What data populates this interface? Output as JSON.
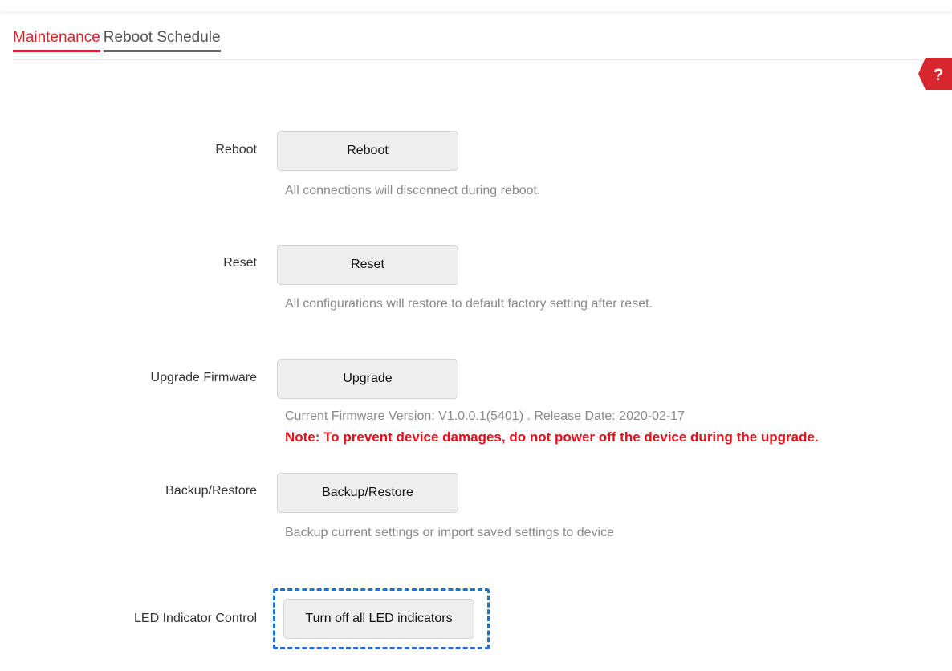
{
  "tabs": [
    {
      "label": "Maintenance",
      "active": true
    },
    {
      "label": "Reboot Schedule",
      "active": false
    }
  ],
  "help_icon": {
    "icon": "help-icon",
    "glyph": "?",
    "color": "#d7262e"
  },
  "rows": {
    "reboot": {
      "label": "Reboot",
      "button": "Reboot",
      "description": "All connections will disconnect during reboot."
    },
    "reset": {
      "label": "Reset",
      "button": "Reset",
      "description": "All configurations will restore to default factory setting after reset."
    },
    "upgrade": {
      "label": "Upgrade Firmware",
      "button": "Upgrade",
      "description": "Current Firmware Version: V1.0.0.1(5401) . Release Date: 2020-02-17",
      "note": "Note: To prevent device damages, do not power off the device during the upgrade."
    },
    "backup": {
      "label": "Backup/Restore",
      "button": "Backup/Restore",
      "description": "Backup current settings or import saved settings to device"
    },
    "led": {
      "label": "LED Indicator Control",
      "button": "Turn off all LED indicators"
    }
  },
  "colors": {
    "accent": "#d7262e",
    "note": "#e6101a",
    "highlight": "#2270d2"
  }
}
